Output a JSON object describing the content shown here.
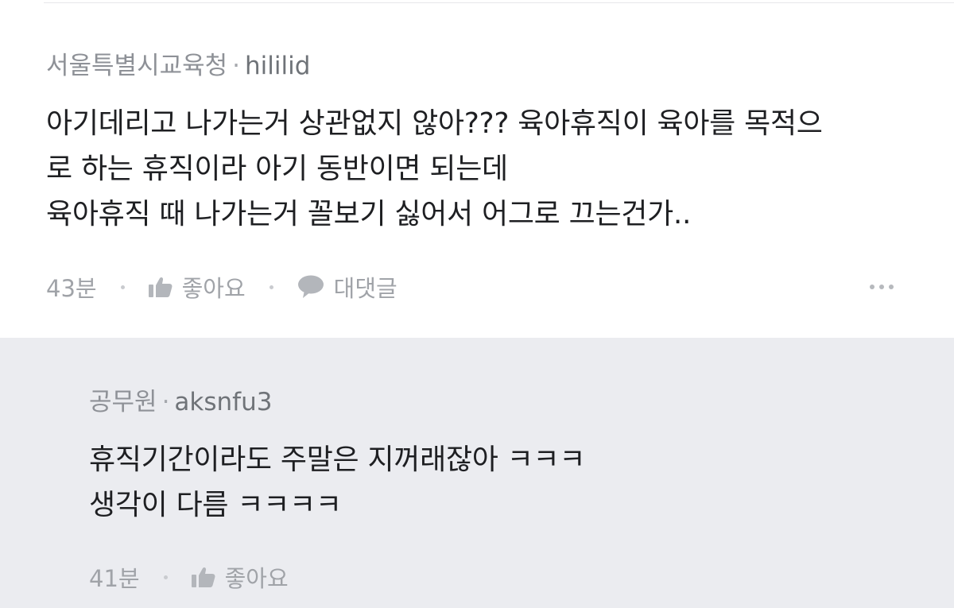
{
  "comment": {
    "affiliation": "서울특별시교육청",
    "separator": "·",
    "nickname": "hililid",
    "lines": [
      "아기데리고 나가는거 상관없지 않아??? 육아휴직이 육아를 목적으",
      "로 하는 휴직이라 아기 동반이면 되는데",
      "육아휴직 때 나가는거 꼴보기 싫어서 어그로 끄는건가.."
    ],
    "time": "43분",
    "like_label": "좋아요",
    "reply_label": "대댓글",
    "more_icon": "more-horizontal-icon"
  },
  "reply": {
    "affiliation": "공무원",
    "separator": "·",
    "nickname": "aksnfu3",
    "lines": [
      "휴직기간이라도 주말은 지꺼래잖아 ㅋㅋㅋ",
      "생각이 다름 ㅋㅋㅋㅋ"
    ],
    "time": "41분",
    "like_label": "좋아요"
  },
  "icons": {
    "like": "thumbs-up-icon",
    "reply": "speech-bubble-icon"
  },
  "colors": {
    "reply_background": "#ebecf0",
    "text": "#1e1f22",
    "meta": "#8e9197"
  }
}
